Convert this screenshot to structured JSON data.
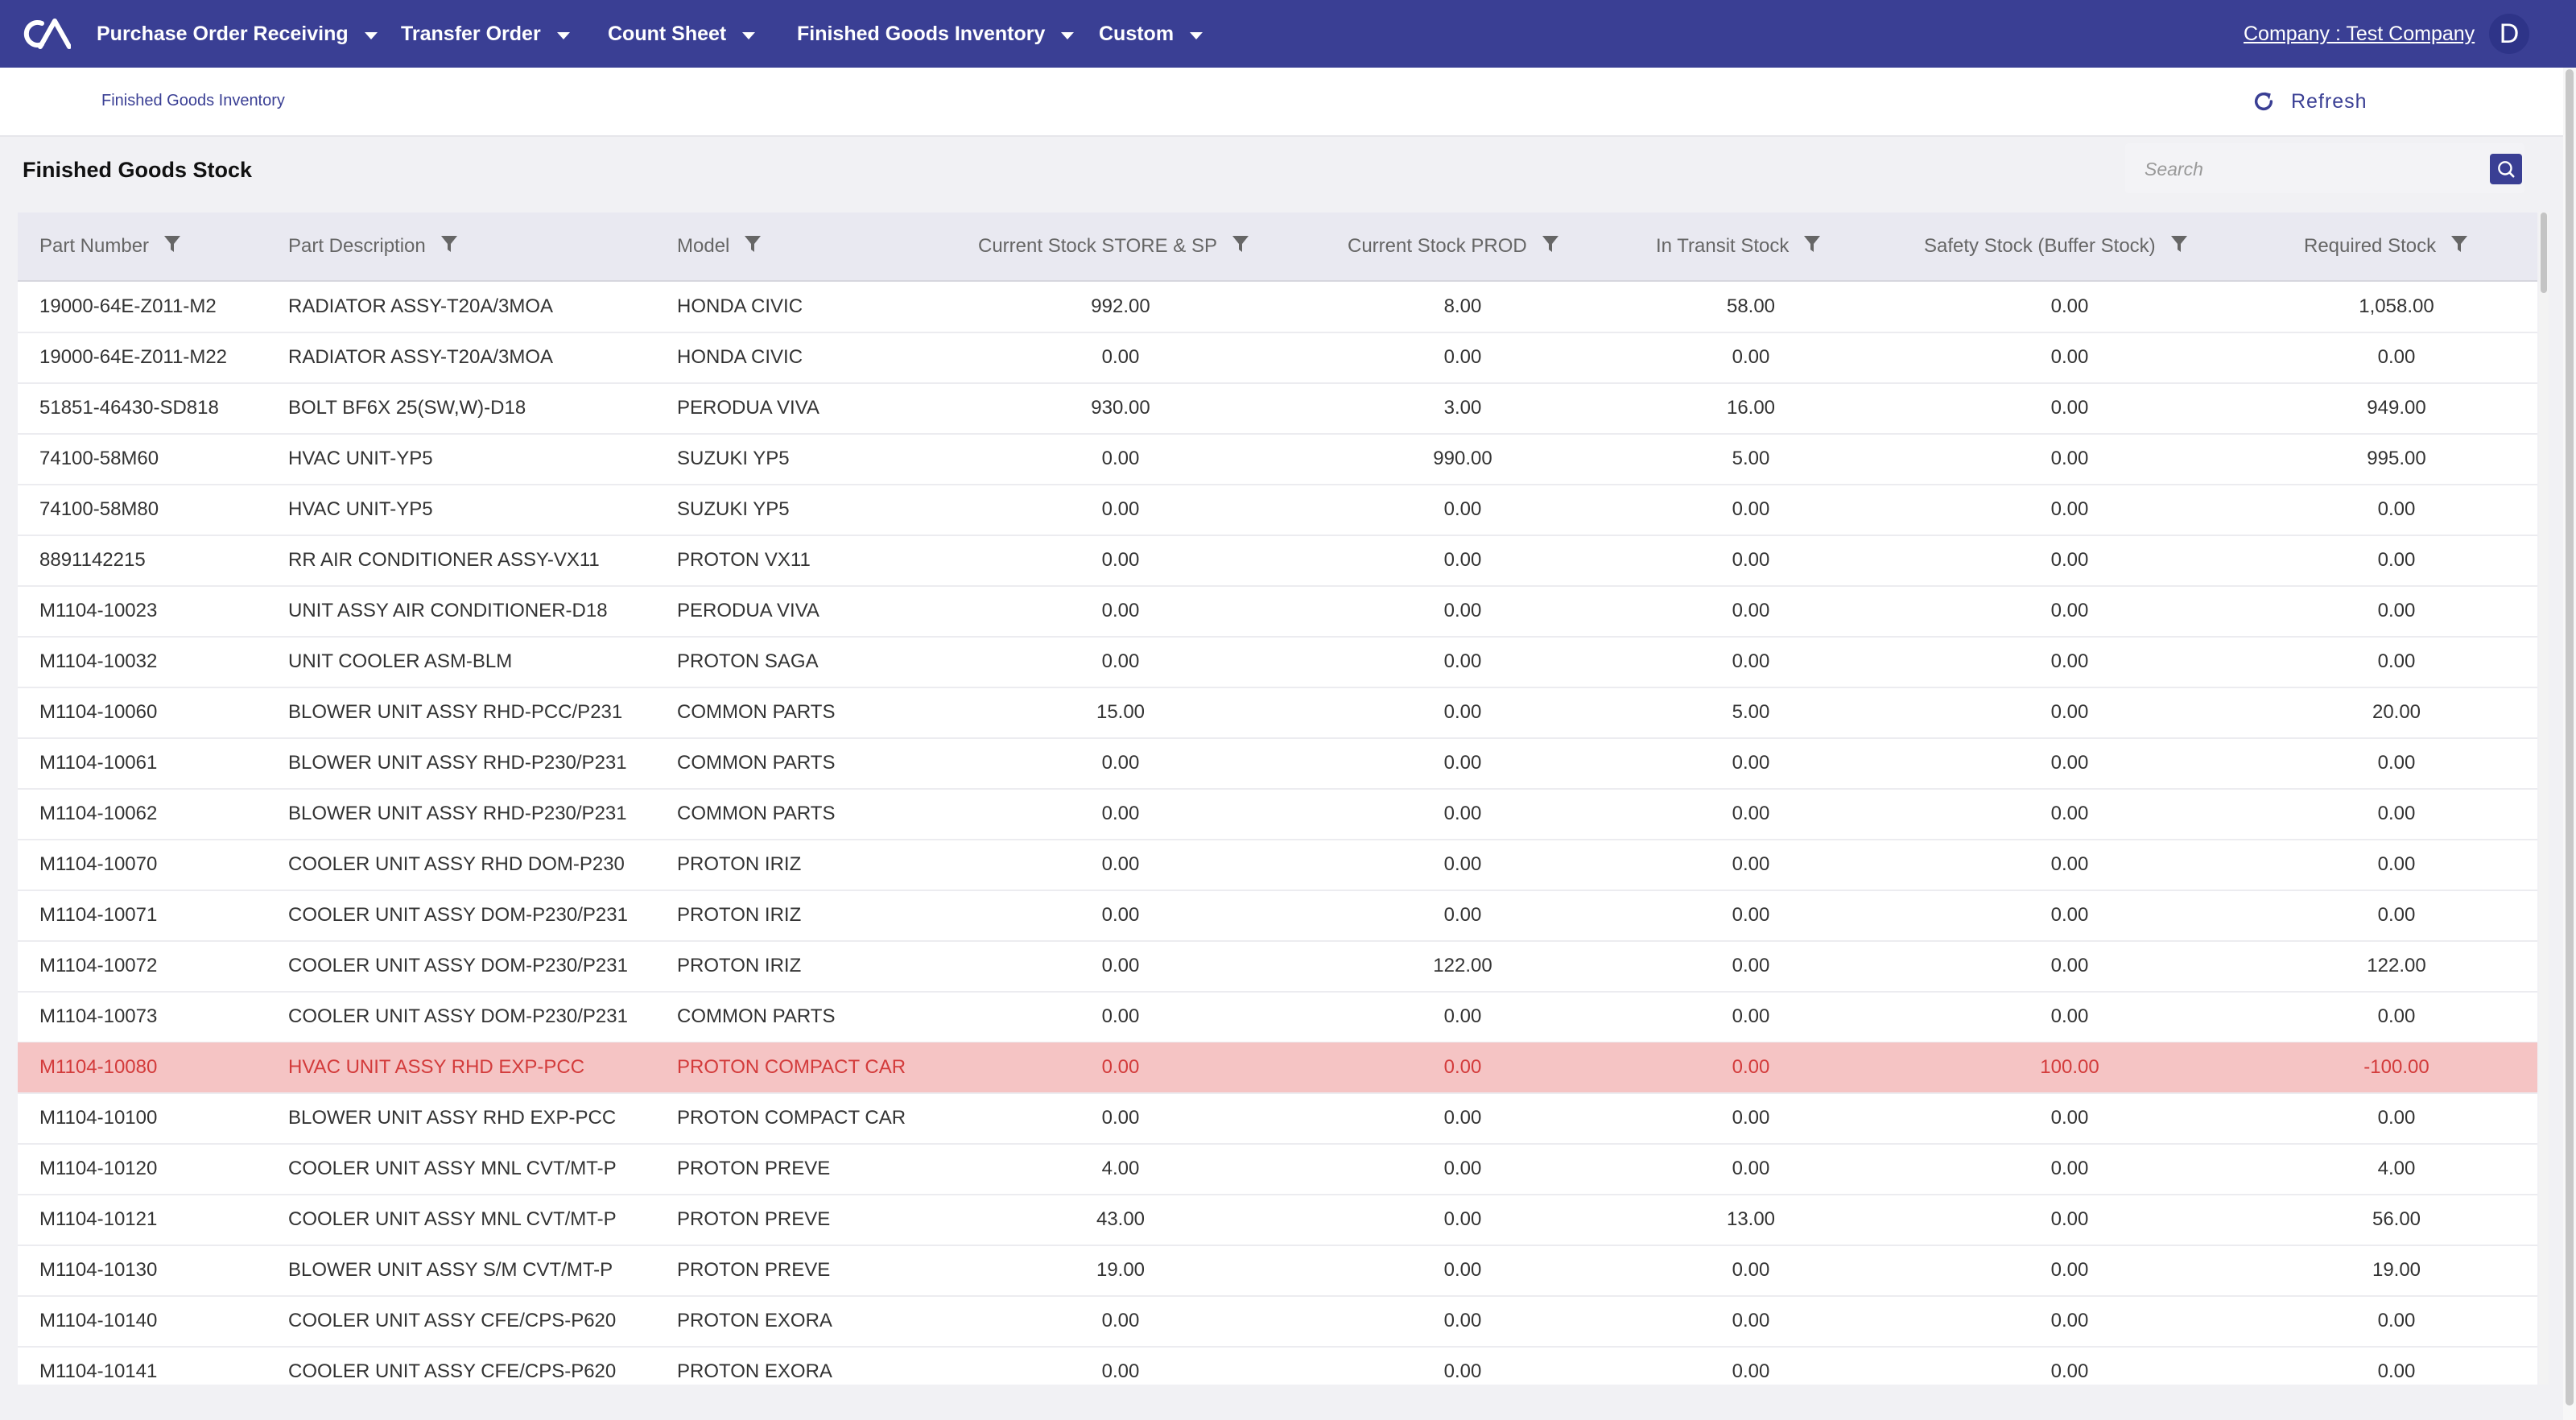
{
  "topbar": {
    "logo_icon": "ca-logo-icon",
    "nav_items": [
      "Purchase Order Receiving",
      "Transfer Order",
      "Count Sheet",
      "Finished Goods Inventory",
      "Custom"
    ],
    "company_label": "Company : Test Company",
    "avatar_letter": "D"
  },
  "breadcrumb": {
    "label": "Finished Goods Inventory"
  },
  "toolbar": {
    "refresh_label": "Refresh",
    "refresh_icon": "refresh-icon"
  },
  "page": {
    "title": "Finished Goods Stock"
  },
  "search": {
    "placeholder": "Search",
    "value": "",
    "icon": "search-icon"
  },
  "colors": {
    "primary": "#3a3f94",
    "alert_row_bg": "#f5c4c4",
    "alert_text": "#d33b3b"
  },
  "table": {
    "columns": [
      "Part Number",
      "Part Description",
      "Model",
      "Current Stock STORE & SP",
      "Current Stock PROD",
      "In Transit Stock",
      "Safety Stock (Buffer Stock)",
      "Required Stock"
    ],
    "filter_icon": "filter-icon",
    "rows": [
      {
        "cells": [
          "19000-64E-Z011-M2",
          "RADIATOR ASSY-T20A/3MOA",
          "HONDA CIVIC",
          "992.00",
          "8.00",
          "58.00",
          "0.00",
          "1,058.00"
        ],
        "alert": false
      },
      {
        "cells": [
          "19000-64E-Z011-M22",
          "RADIATOR ASSY-T20A/3MOA",
          "HONDA CIVIC",
          "0.00",
          "0.00",
          "0.00",
          "0.00",
          "0.00"
        ],
        "alert": false
      },
      {
        "cells": [
          "51851-46430-SD818",
          "BOLT BF6X 25(SW,W)-D18",
          "PERODUA VIVA",
          "930.00",
          "3.00",
          "16.00",
          "0.00",
          "949.00"
        ],
        "alert": false
      },
      {
        "cells": [
          "74100-58M60",
          "HVAC UNIT-YP5",
          "SUZUKI YP5",
          "0.00",
          "990.00",
          "5.00",
          "0.00",
          "995.00"
        ],
        "alert": false
      },
      {
        "cells": [
          "74100-58M80",
          "HVAC UNIT-YP5",
          "SUZUKI YP5",
          "0.00",
          "0.00",
          "0.00",
          "0.00",
          "0.00"
        ],
        "alert": false
      },
      {
        "cells": [
          "8891142215",
          "RR AIR CONDITIONER ASSY-VX11",
          "PROTON VX11",
          "0.00",
          "0.00",
          "0.00",
          "0.00",
          "0.00"
        ],
        "alert": false
      },
      {
        "cells": [
          "M1104-10023",
          "UNIT ASSY AIR CONDITIONER-D18",
          "PERODUA VIVA",
          "0.00",
          "0.00",
          "0.00",
          "0.00",
          "0.00"
        ],
        "alert": false
      },
      {
        "cells": [
          "M1104-10032",
          "UNIT COOLER ASM-BLM",
          "PROTON SAGA",
          "0.00",
          "0.00",
          "0.00",
          "0.00",
          "0.00"
        ],
        "alert": false
      },
      {
        "cells": [
          "M1104-10060",
          "BLOWER UNIT ASSY RHD-PCC/P231",
          "COMMON PARTS",
          "15.00",
          "0.00",
          "5.00",
          "0.00",
          "20.00"
        ],
        "alert": false
      },
      {
        "cells": [
          "M1104-10061",
          "BLOWER UNIT ASSY RHD-P230/P231",
          "COMMON PARTS",
          "0.00",
          "0.00",
          "0.00",
          "0.00",
          "0.00"
        ],
        "alert": false
      },
      {
        "cells": [
          "M1104-10062",
          "BLOWER UNIT ASSY RHD-P230/P231",
          "COMMON PARTS",
          "0.00",
          "0.00",
          "0.00",
          "0.00",
          "0.00"
        ],
        "alert": false
      },
      {
        "cells": [
          "M1104-10070",
          "COOLER UNIT ASSY RHD DOM-P230",
          "PROTON IRIZ",
          "0.00",
          "0.00",
          "0.00",
          "0.00",
          "0.00"
        ],
        "alert": false
      },
      {
        "cells": [
          "M1104-10071",
          "COOLER UNIT ASSY DOM-P230/P231",
          "PROTON IRIZ",
          "0.00",
          "0.00",
          "0.00",
          "0.00",
          "0.00"
        ],
        "alert": false
      },
      {
        "cells": [
          "M1104-10072",
          "COOLER UNIT ASSY DOM-P230/P231",
          "PROTON IRIZ",
          "0.00",
          "122.00",
          "0.00",
          "0.00",
          "122.00"
        ],
        "alert": false
      },
      {
        "cells": [
          "M1104-10073",
          "COOLER UNIT ASSY DOM-P230/P231",
          "COMMON PARTS",
          "0.00",
          "0.00",
          "0.00",
          "0.00",
          "0.00"
        ],
        "alert": false
      },
      {
        "cells": [
          "M1104-10080",
          "HVAC UNIT ASSY RHD EXP-PCC",
          "PROTON COMPACT CAR",
          "0.00",
          "0.00",
          "0.00",
          "100.00",
          "-100.00"
        ],
        "alert": true
      },
      {
        "cells": [
          "M1104-10100",
          "BLOWER UNIT ASSY RHD EXP-PCC",
          "PROTON COMPACT CAR",
          "0.00",
          "0.00",
          "0.00",
          "0.00",
          "0.00"
        ],
        "alert": false
      },
      {
        "cells": [
          "M1104-10120",
          "COOLER UNIT ASSY MNL CVT/MT-P",
          "PROTON PREVE",
          "4.00",
          "0.00",
          "0.00",
          "0.00",
          "4.00"
        ],
        "alert": false
      },
      {
        "cells": [
          "M1104-10121",
          "COOLER UNIT ASSY MNL CVT/MT-P",
          "PROTON PREVE",
          "43.00",
          "0.00",
          "13.00",
          "0.00",
          "56.00"
        ],
        "alert": false
      },
      {
        "cells": [
          "M1104-10130",
          "BLOWER UNIT ASSY S/M CVT/MT-P",
          "PROTON PREVE",
          "19.00",
          "0.00",
          "0.00",
          "0.00",
          "19.00"
        ],
        "alert": false
      },
      {
        "cells": [
          "M1104-10140",
          "COOLER UNIT ASSY CFE/CPS-P620",
          "PROTON EXORA",
          "0.00",
          "0.00",
          "0.00",
          "0.00",
          "0.00"
        ],
        "alert": false
      },
      {
        "cells": [
          "M1104-10141",
          "COOLER UNIT ASSY CFE/CPS-P620",
          "PROTON EXORA",
          "0.00",
          "0.00",
          "0.00",
          "0.00",
          "0.00"
        ],
        "alert": false
      }
    ]
  }
}
